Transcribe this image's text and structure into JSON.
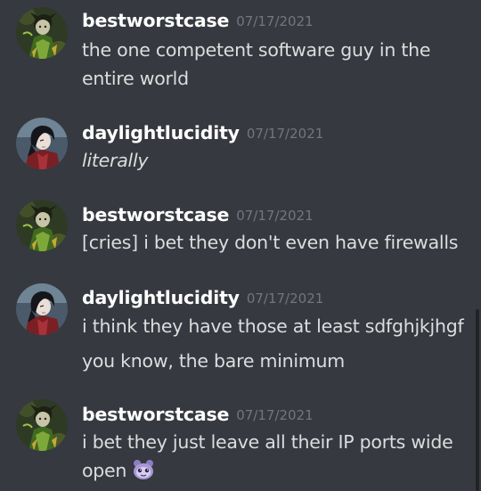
{
  "messages": [
    {
      "username": "bestworstcase",
      "timestamp": "07/17/2021",
      "lines": [
        "the one competent software guy in the",
        "entire world"
      ],
      "avatar_icon": "avatar-green-robed-character-icon"
    },
    {
      "username": "daylightlucidity",
      "timestamp": "07/17/2021",
      "lines": [
        "literally"
      ],
      "avatar_icon": "avatar-dark-haired-character-icon"
    },
    {
      "username": "bestworstcase",
      "timestamp": "07/17/2021",
      "lines": [
        "[cries] i bet they don't even have firewalls"
      ],
      "avatar_icon": "avatar-green-robed-character-icon"
    },
    {
      "username": "daylightlucidity",
      "timestamp": "07/17/2021",
      "lines": [
        "i think they have those at least sdfghjkjhgf",
        "you know, the bare minimum"
      ],
      "avatar_icon": "avatar-dark-haired-character-icon"
    },
    {
      "username": "bestworstcase",
      "timestamp": "07/17/2021",
      "lines": [
        "i bet they just leave all their IP ports wide",
        "open"
      ],
      "emoji": "purple-creature-emoji",
      "avatar_icon": "avatar-green-robed-character-icon"
    }
  ],
  "colors": {
    "background": "#36393f",
    "username": "#ffffff",
    "message_text": "#dcddde",
    "timestamp": "#72767d",
    "scrollbar_thumb": "#202225"
  }
}
